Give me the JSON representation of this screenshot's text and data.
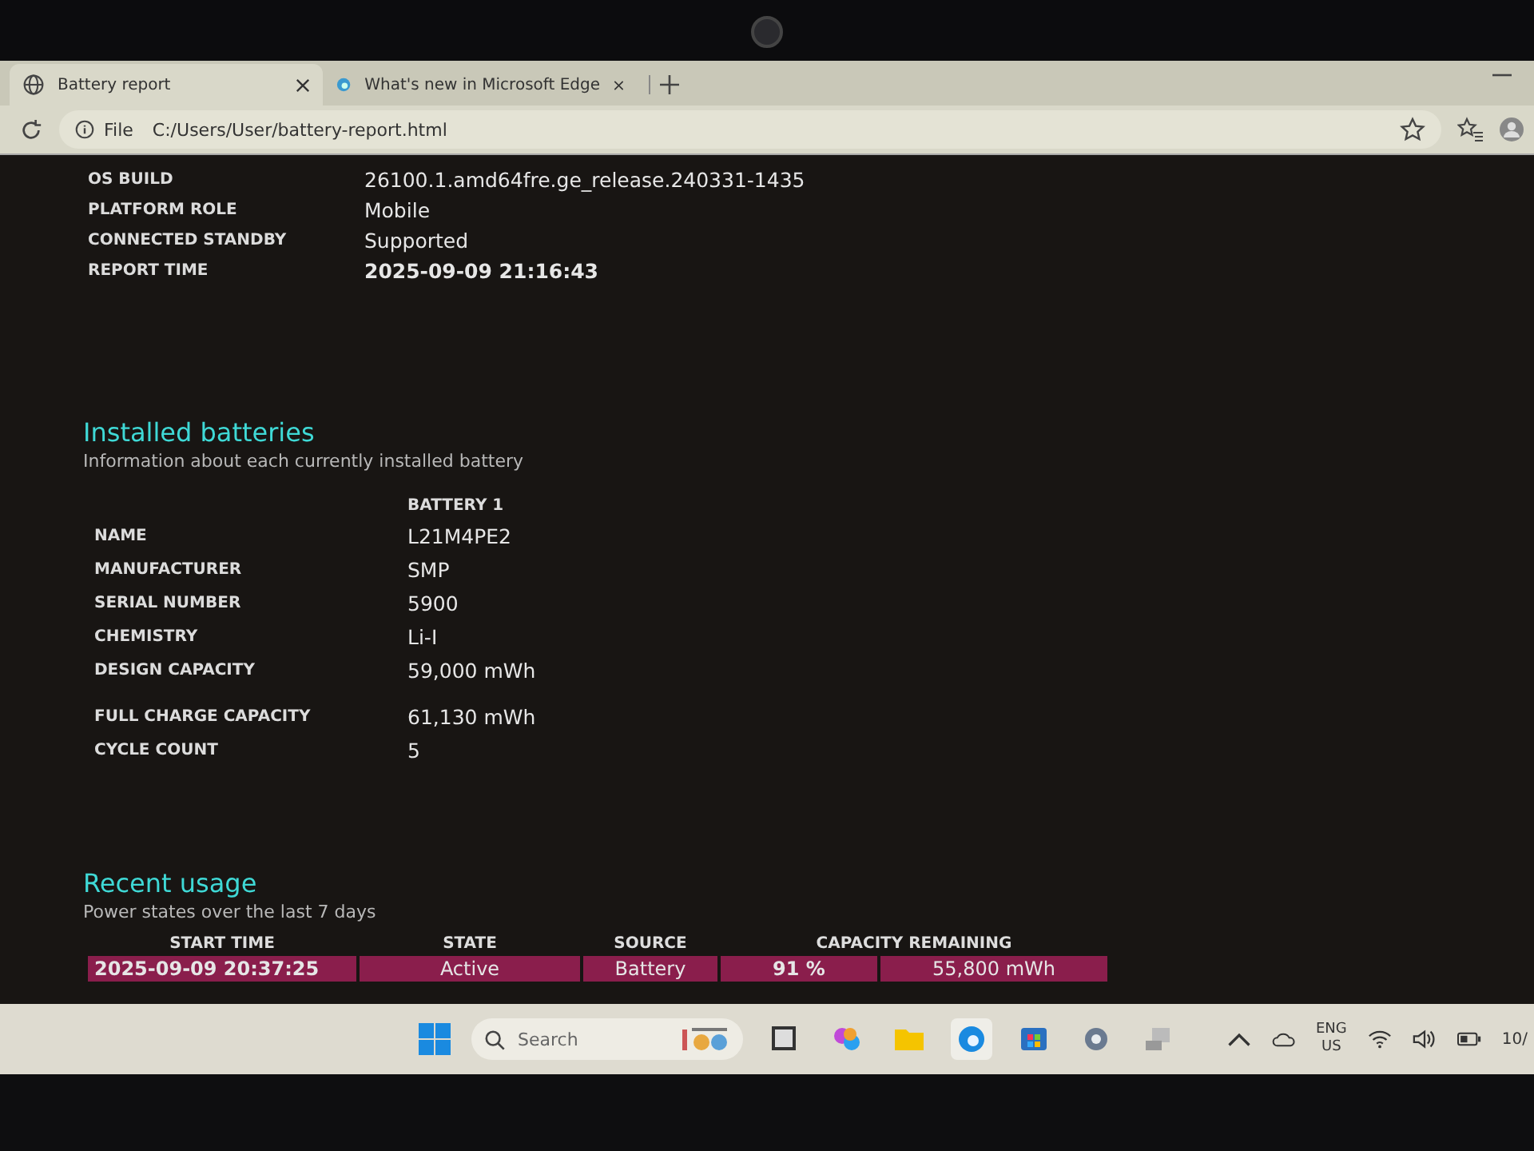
{
  "browser": {
    "tabs": [
      {
        "title": "Battery report",
        "selected": true
      },
      {
        "title": "What's new in Microsoft Edge",
        "selected": false
      }
    ],
    "address": {
      "scheme": "File",
      "url": "C:/Users/User/battery-report.html"
    }
  },
  "system_info": [
    {
      "label": "OS BUILD",
      "value": "26100.1.amd64fre.ge_release.240331-1435",
      "bold": false
    },
    {
      "label": "PLATFORM ROLE",
      "value": "Mobile",
      "bold": false
    },
    {
      "label": "CONNECTED STANDBY",
      "value": "Supported",
      "bold": false
    },
    {
      "label": "REPORT TIME",
      "value": "2025-09-09  21:16:43",
      "bold": true
    }
  ],
  "installed_batteries": {
    "title": "Installed batteries",
    "subtitle": "Information about each currently installed battery",
    "column": "BATTERY 1",
    "rows": [
      {
        "label": "NAME",
        "value": "L21M4PE2"
      },
      {
        "label": "MANUFACTURER",
        "value": "SMP"
      },
      {
        "label": "SERIAL NUMBER",
        "value": "5900"
      },
      {
        "label": "CHEMISTRY",
        "value": "Li-I"
      },
      {
        "label": "DESIGN CAPACITY",
        "value": "59,000 mWh"
      },
      {
        "label": "FULL CHARGE CAPACITY",
        "value": "61,130 mWh"
      },
      {
        "label": "CYCLE COUNT",
        "value": "5"
      }
    ]
  },
  "recent_usage": {
    "title": "Recent usage",
    "subtitle": "Power states over the last 7 days",
    "columns": [
      "START TIME",
      "STATE",
      "SOURCE",
      "CAPACITY REMAINING"
    ],
    "rows": [
      {
        "start_time": "2025-09-09  20:37:25",
        "state": "Active",
        "source": "Battery",
        "percent": "91 %",
        "capacity": "55,800 mWh"
      }
    ]
  },
  "taskbar": {
    "search_placeholder": "Search",
    "language": "ENG",
    "region": "US",
    "clock": "10/"
  }
}
